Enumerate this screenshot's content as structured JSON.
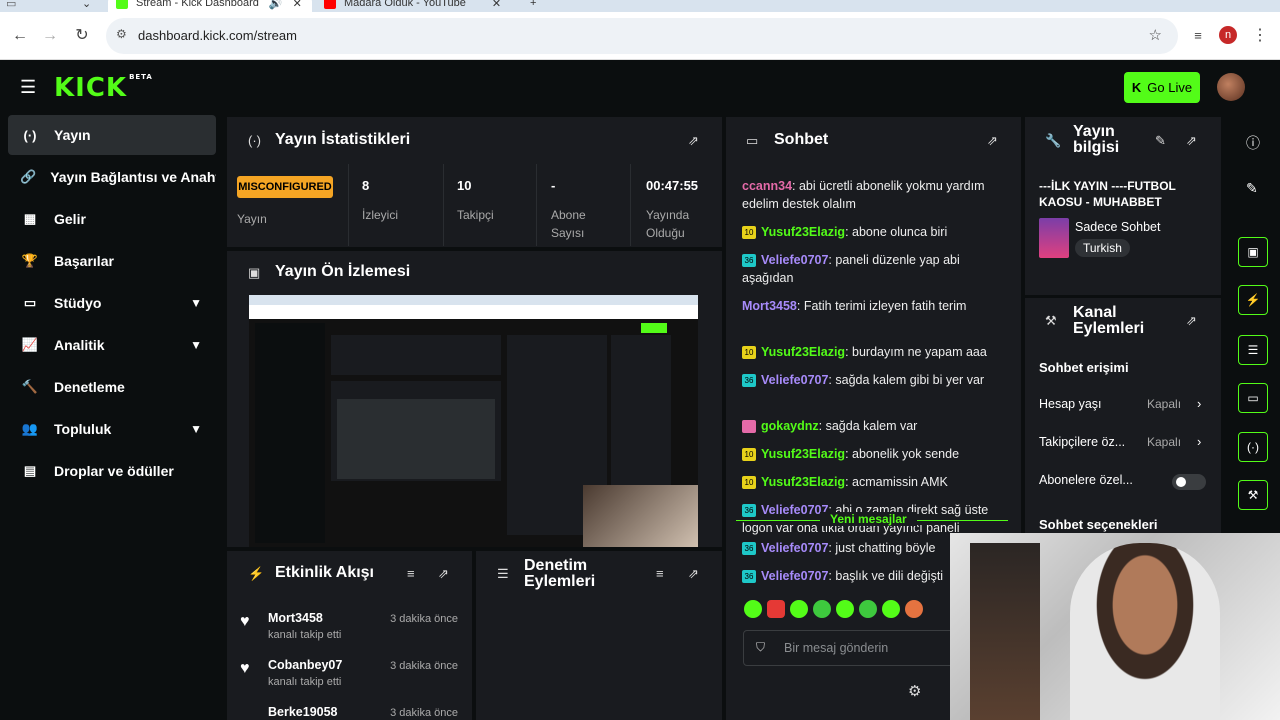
{
  "browser": {
    "tabs": [
      {
        "title": "Stream - Kick Dashboard"
      },
      {
        "title": "Madara Olduk - YouTube"
      }
    ],
    "url": "dashboard.kick.com/stream",
    "profile_initial": "n"
  },
  "header": {
    "logo": "KICK",
    "logo_badge": "BETA",
    "go_live_label": "Go Live"
  },
  "sidebar": {
    "items": [
      {
        "label": "Yayın",
        "icon": "stream-icon"
      },
      {
        "label": "Yayın Bağlantısı ve Anahtarı",
        "icon": "link-icon"
      },
      {
        "label": "Gelir",
        "icon": "revenue-icon"
      },
      {
        "label": "Başarılar",
        "icon": "trophy-icon"
      },
      {
        "label": "Stüdyo",
        "icon": "studio-icon"
      },
      {
        "label": "Analitik",
        "icon": "analytics-icon"
      },
      {
        "label": "Denetleme",
        "icon": "moderation-icon"
      },
      {
        "label": "Topluluk",
        "icon": "community-icon"
      },
      {
        "label": "Droplar ve ödüller",
        "icon": "drops-icon"
      }
    ]
  },
  "stats": {
    "title": "Yayın İstatistikleri",
    "status_badge": "MISCONFIGURED",
    "status_label": "Yayın",
    "items": [
      {
        "value": "8",
        "label": "İzleyici"
      },
      {
        "value": "10",
        "label": "Takipçi"
      },
      {
        "value": "-",
        "label": "Abone Sayısı"
      },
      {
        "value": "00:47:55",
        "label": "Yayında Olduğu Süre"
      }
    ]
  },
  "preview": {
    "title": "Yayın Ön İzlemesi"
  },
  "activity": {
    "title": "Etkinlik Akışı",
    "items": [
      {
        "name": "Mort3458",
        "time": "3 dakika önce",
        "action": "kanalı takip etti"
      },
      {
        "name": "Cobanbey07",
        "time": "3 dakika önce",
        "action": "kanalı takip etti"
      },
      {
        "name": "Berke19058",
        "time": "3 dakika önce",
        "action": ""
      }
    ]
  },
  "moderation": {
    "title": "Denetim Eylemleri"
  },
  "chat": {
    "title": "Sohbet",
    "messages": [
      {
        "user": "ccann34",
        "badge": "",
        "color": "#e46aa8",
        "text": "abi ücretli abonelik yokmu yardım edelim destek olalım"
      },
      {
        "user": "Yusuf23Elazig",
        "badge": "10",
        "color": "#53fc18",
        "text": "abone olunca biri"
      },
      {
        "user": "Veliefe0707",
        "badge": "36",
        "color": "#a78bfa",
        "text": "paneli düzenle yap abi aşağıdan"
      },
      {
        "user": "Mort3458",
        "badge": "",
        "color": "#a78bfa",
        "text": "Fatih terimi izleyen fatih terim"
      },
      {
        "user": "Yusuf23Elazig",
        "badge": "10",
        "color": "#53fc18",
        "text": "burdayım ne yapam aaa"
      },
      {
        "user": "Veliefe0707",
        "badge": "36",
        "color": "#a78bfa",
        "text": "sağda kalem gibi bi yer var"
      },
      {
        "user": "gokaydnz",
        "badge": "crown",
        "color": "#53fc18",
        "text": "sağda kalem var"
      },
      {
        "user": "Yusuf23Elazig",
        "badge": "10",
        "color": "#53fc18",
        "text": "abonelik yok sende"
      },
      {
        "user": "Yusuf23Elazig",
        "badge": "10",
        "color": "#53fc18",
        "text": "acmamissin AMK"
      },
      {
        "user": "Veliefe0707",
        "badge": "36",
        "color": "#a78bfa",
        "text": "abi o zaman direkt sağ üste logon var ona tıkla ordan yayıncı paneli"
      }
    ],
    "new_messages_label": "Yeni mesajlar",
    "new_messages": [
      {
        "user": "Veliefe0707",
        "badge": "36",
        "color": "#a78bfa",
        "text": "just chatting böyle"
      },
      {
        "user": "Veliefe0707",
        "badge": "36",
        "color": "#a78bfa",
        "text": "başlık ve dili değişti"
      }
    ],
    "input_placeholder": "Bir mesaj gönderin"
  },
  "stream_info": {
    "title": "Yayın bilgisi",
    "stream_title": "---İLK YAYIN ----FUTBOL KAOSU - MUHABBET",
    "category": "Sadece Sohbet",
    "language": "Turkish"
  },
  "channel_actions": {
    "title": "Kanal Eylemleri",
    "chat_access_heading": "Sohbet erişimi",
    "rows": [
      {
        "label": "Hesap yaşı",
        "value": "Kapalı"
      },
      {
        "label": "Takipçilere öz...",
        "value": "Kapalı"
      },
      {
        "label": "Abonelere özel...",
        "value": ""
      }
    ],
    "subscriber_toggle_on": false,
    "chat_options_heading": "Sohbet seçenekleri"
  },
  "colors": {
    "accent": "#53fc18",
    "panel": "#191b1f",
    "background": "#0b0e0f",
    "warning": "#f5a524"
  }
}
